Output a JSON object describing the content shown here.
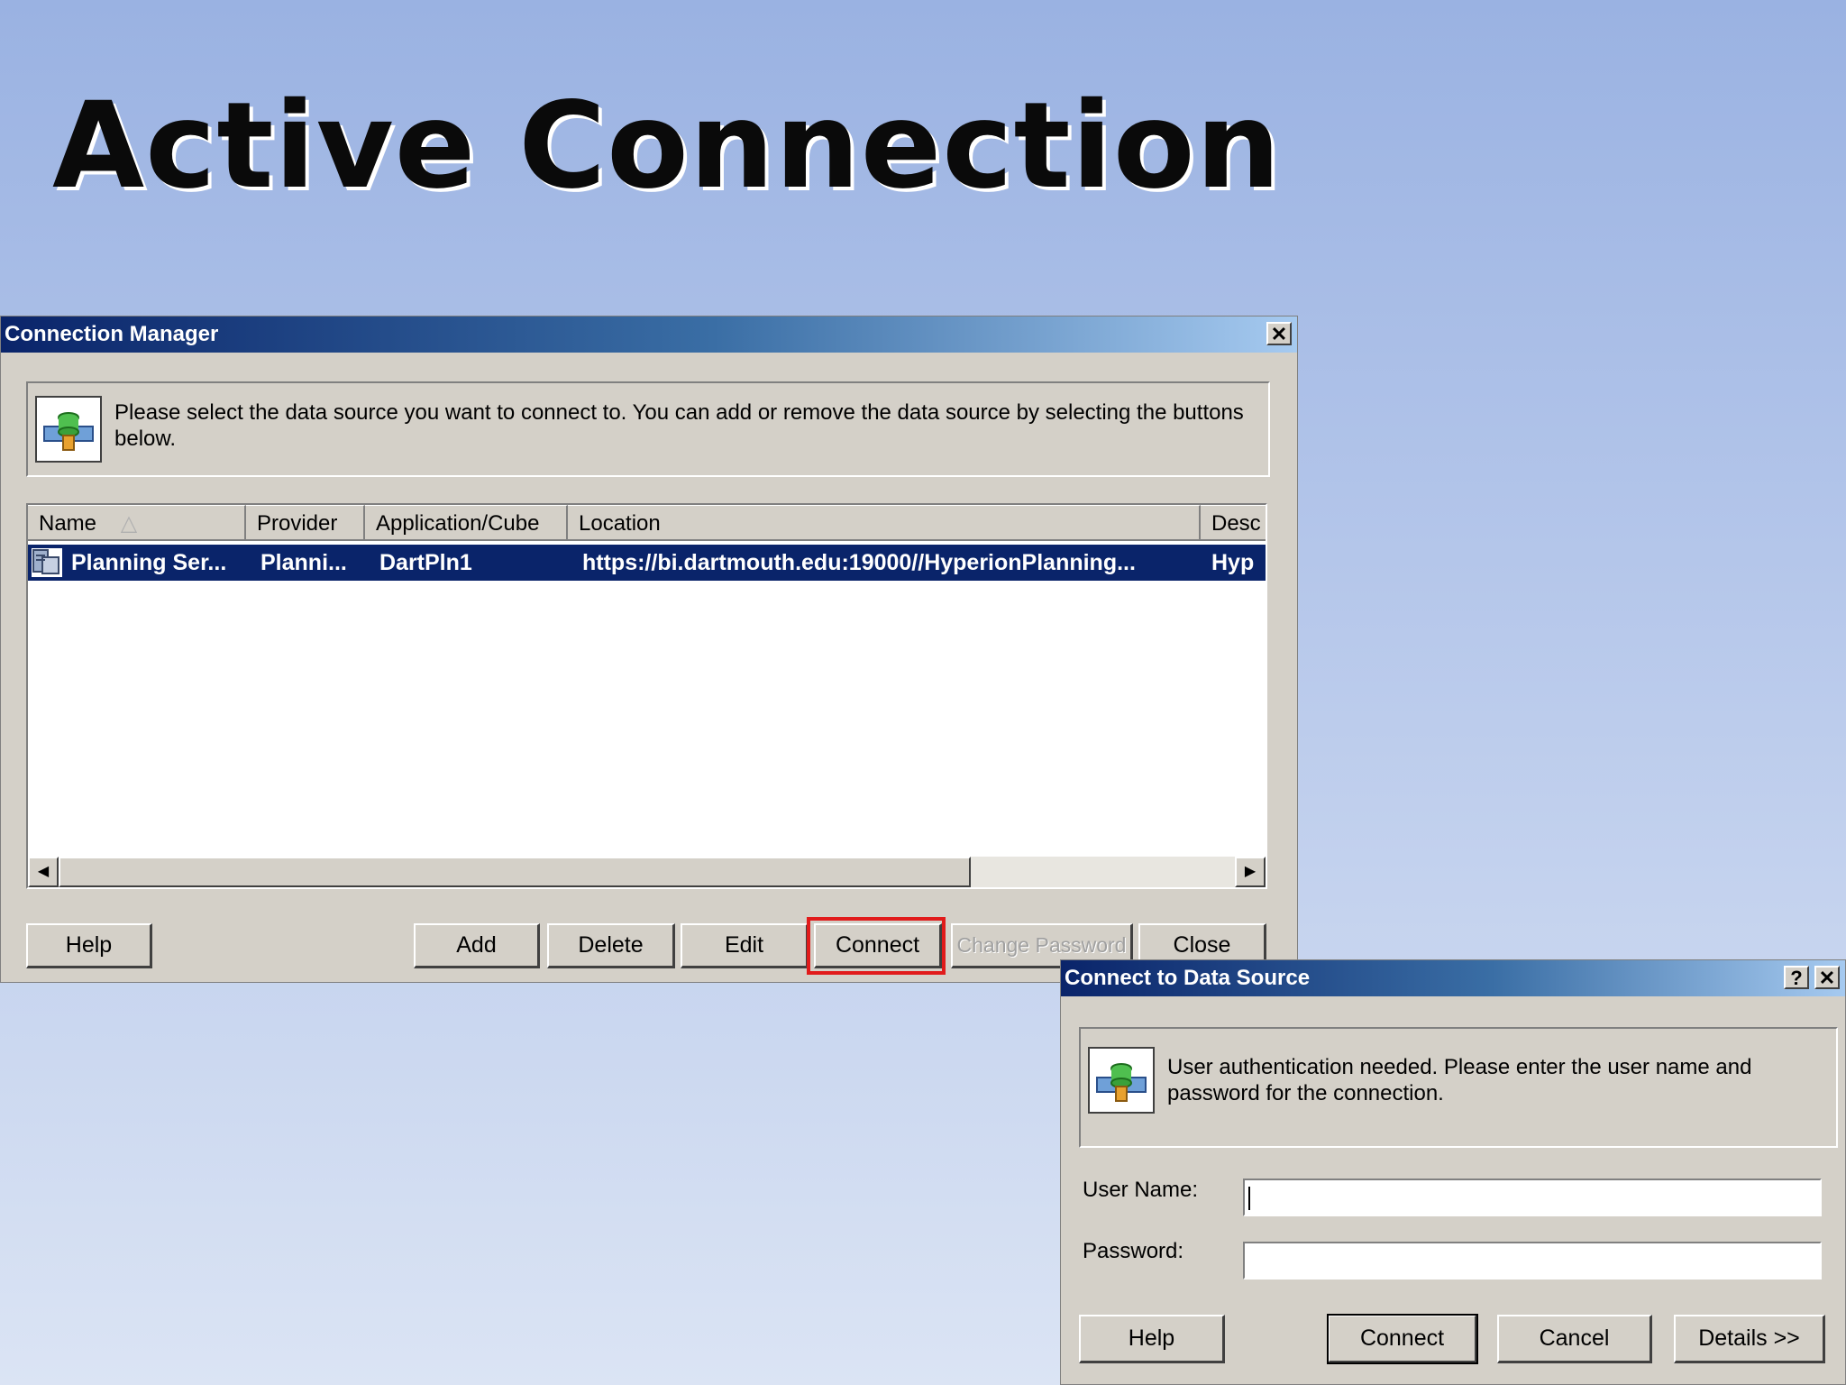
{
  "slide": {
    "title": "Active Connection"
  },
  "connection_manager": {
    "title": "Connection Manager",
    "close_glyph": "✕",
    "message": "Please select the data source you want to connect to. You can add or remove the data source by selecting the buttons below.",
    "columns": [
      "Name",
      "Provider",
      "Application/Cube",
      "Location",
      "Desc"
    ],
    "sort_indicator": "△",
    "rows": [
      {
        "name": "Planning Ser...",
        "provider": "Planni...",
        "application": "DartPln1",
        "location": "https://bi.dartmouth.edu:19000//HyperionPlanning...",
        "description": "Hyp"
      }
    ],
    "buttons": {
      "help": "Help",
      "add": "Add",
      "delete": "Delete",
      "edit": "Edit",
      "connect": "Connect",
      "change_password": "Change Password",
      "close": "Close"
    },
    "highlight_color": "#e11b1b"
  },
  "connect_dialog": {
    "title": "Connect to Data Source",
    "help_glyph": "?",
    "close_glyph": "✕",
    "message": "User authentication needed.  Please enter the user name and password for the connection.",
    "user_name_label": "User Name:",
    "user_name_value": "",
    "password_label": "Password:",
    "password_value": "",
    "buttons": {
      "help": "Help",
      "connect": "Connect",
      "cancel": "Cancel",
      "details": "Details >>"
    }
  },
  "colors": {
    "titlebar": "#0a246a",
    "selection": "#0a246a",
    "dialog_face": "#d4d0c8"
  }
}
